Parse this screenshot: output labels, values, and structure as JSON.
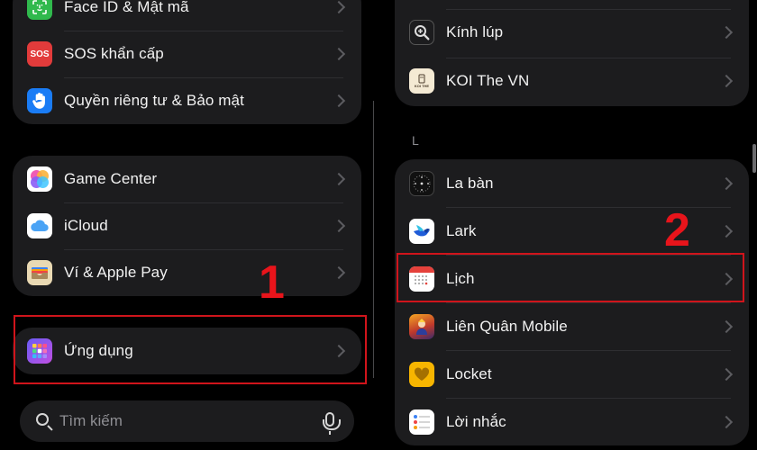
{
  "left_panel": {
    "group1": [
      {
        "label": "Face ID & Mật mã",
        "icon": "face-id-icon",
        "color": "#30b94d"
      },
      {
        "label": "SOS khẩn cấp",
        "icon": "sos-icon",
        "icon_text": "SOS",
        "color": "#e23b3b"
      },
      {
        "label": "Quyền riêng tư & Bảo mật",
        "icon": "hand-icon",
        "color": "#1a7cf5"
      }
    ],
    "group2": [
      {
        "label": "Game Center",
        "icon": "game-center-icon"
      },
      {
        "label": "iCloud",
        "icon": "icloud-icon"
      },
      {
        "label": "Ví & Apple Pay",
        "icon": "wallet-icon"
      }
    ],
    "group3": [
      {
        "label": "Ứng dụng",
        "icon": "apps-grid-icon"
      }
    ],
    "search": {
      "placeholder": "Tìm kiếm"
    },
    "step_label": "1"
  },
  "right_panel": {
    "group1": [
      {
        "label": "Kính lúp",
        "icon": "magnifier-icon"
      },
      {
        "label": "KOI The VN",
        "icon": "koi-icon",
        "icon_text": "KOI THE"
      }
    ],
    "section_letter": "L",
    "group2": [
      {
        "label": "La bàn",
        "icon": "compass-icon"
      },
      {
        "label": "Lark",
        "icon": "lark-icon"
      },
      {
        "label": "Lịch",
        "icon": "calendar-icon"
      },
      {
        "label": "Liên Quân Mobile",
        "icon": "lien-quan-icon"
      },
      {
        "label": "Locket",
        "icon": "locket-heart-icon"
      },
      {
        "label": "Lời nhắc",
        "icon": "reminders-icon"
      }
    ],
    "step_label": "2"
  },
  "colors": {
    "background": "#000000",
    "group_bg": "#1c1c1e",
    "highlight_red": "#d0141b",
    "step_number_red": "#e8141b"
  }
}
